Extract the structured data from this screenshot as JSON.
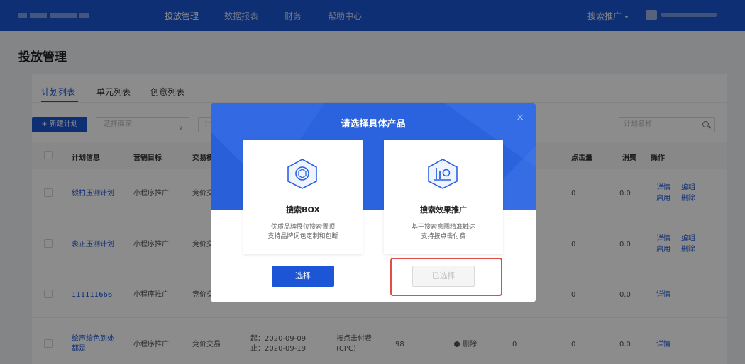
{
  "nav": {
    "items": [
      "投放管理",
      "数据报表",
      "财务",
      "帮助中心"
    ],
    "right_menu": "搜索推广"
  },
  "page": {
    "title": "投放管理"
  },
  "tabs": [
    "计划列表",
    "单元列表",
    "创意列表"
  ],
  "toolbar": {
    "new_plan": "+ 新建计划",
    "select_placeholder": "选择商家",
    "select2_placeholder": "计",
    "search_placeholder": "计划名称"
  },
  "table": {
    "headers": {
      "plan_info": "计划信息",
      "target": "营销目标",
      "trade": "交易模",
      "clicks": "点击量",
      "spend": "消费",
      "actions": "操作"
    },
    "rows": [
      {
        "name": "毅柏压测计划",
        "target": "小程序推广",
        "trade": "竞价交",
        "clicks": "0",
        "spend": "0.0",
        "actions": [
          "详情",
          "编辑",
          "启用",
          "删除"
        ]
      },
      {
        "name": "衷正压测计划",
        "target": "小程序推广",
        "trade": "竞价交",
        "clicks": "0",
        "spend": "0.0",
        "actions": [
          "详情",
          "编辑",
          "启用",
          "删除"
        ]
      },
      {
        "name": "111111666",
        "target": "小程序推广",
        "trade": "竞价交",
        "clicks": "0",
        "spend": "0.0",
        "actions": [
          "详情"
        ]
      },
      {
        "name_line1": "绘声绘色到处",
        "name_line2": "都是",
        "target": "小程序推广",
        "trade": "竞价交易",
        "start": "起：2020-09-09",
        "end": "止：2020-09-19",
        "billing_line1": "按点击付费",
        "billing_line2": "(CPC)",
        "budget": "98",
        "status": "删除",
        "col_x": "0",
        "clicks": "0",
        "spend": "0.0",
        "actions": [
          "详情"
        ]
      }
    ]
  },
  "modal": {
    "title": "请选择具体产品",
    "close": "×",
    "products": [
      {
        "name": "搜索BOX",
        "desc1": "优质品牌展位搜索置顶",
        "desc2": "支持品牌词包定制和包断",
        "button": "选择"
      },
      {
        "name": "搜索效果推广",
        "desc1": "基于搜索意图精准触达",
        "desc2": "支持按点击付费",
        "button": "已选择"
      }
    ]
  },
  "colors": {
    "brand": "#1c56d6",
    "highlight": "#e14c43"
  }
}
